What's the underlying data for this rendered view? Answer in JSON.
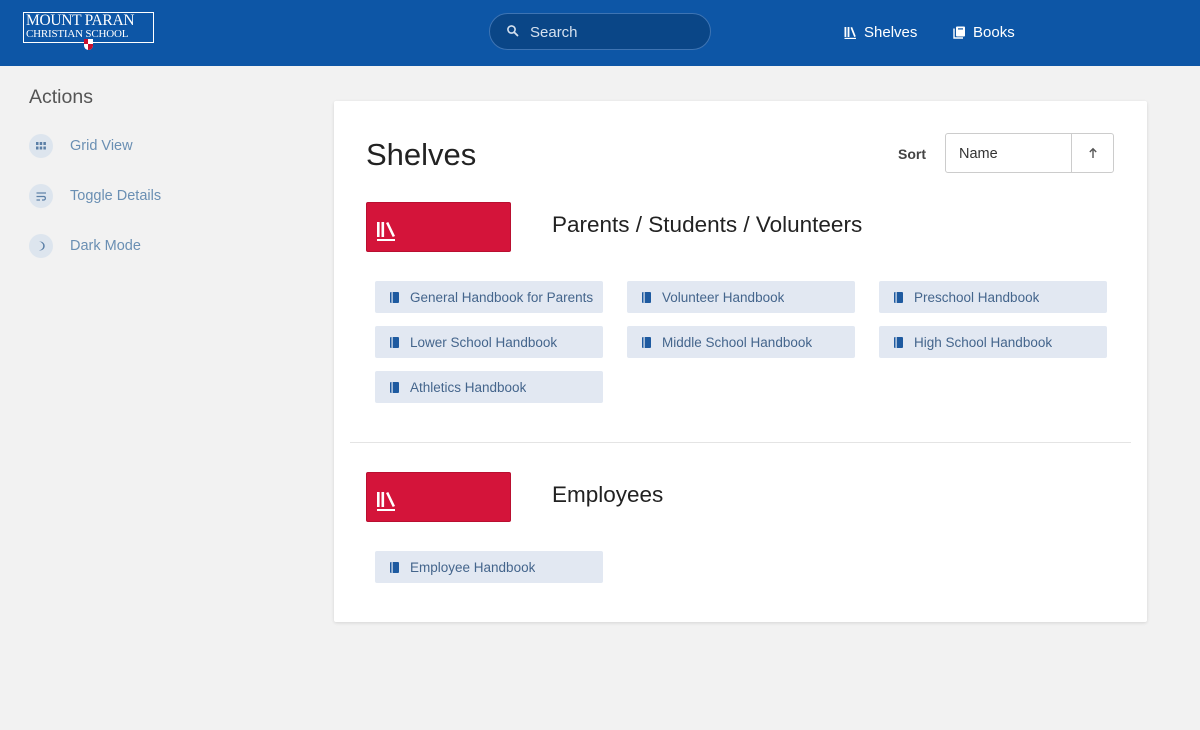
{
  "header": {
    "logo_line1": "MOUNT PARAN",
    "logo_line2": "CHRISTIAN SCHOOL",
    "search_placeholder": "Search",
    "nav": [
      {
        "label": "Shelves",
        "icon": "shelves-icon"
      },
      {
        "label": "Books",
        "icon": "books-icon"
      }
    ]
  },
  "sidebar": {
    "title": "Actions",
    "actions": [
      {
        "label": "Grid View",
        "icon": "grid-icon"
      },
      {
        "label": "Toggle Details",
        "icon": "toggle-details-icon"
      },
      {
        "label": "Dark Mode",
        "icon": "moon-icon"
      }
    ]
  },
  "main": {
    "title": "Shelves",
    "sort": {
      "label": "Sort",
      "value": "Name",
      "direction_icon": "arrow-up-icon"
    },
    "shelves": [
      {
        "name": "Parents / Students / Volunteers",
        "books": [
          "General Handbook for Parents",
          "Volunteer Handbook",
          "Preschool Handbook",
          "Lower School Handbook",
          "Middle School Handbook",
          "High School Handbook",
          "Athletics Handbook"
        ]
      },
      {
        "name": "Employees",
        "books": [
          "Employee Handbook"
        ]
      }
    ]
  },
  "colors": {
    "header_bg": "#0d56a6",
    "shelf_accent": "#d4143a",
    "book_chip_bg": "#e2e8f2",
    "book_text": "#44658c"
  }
}
